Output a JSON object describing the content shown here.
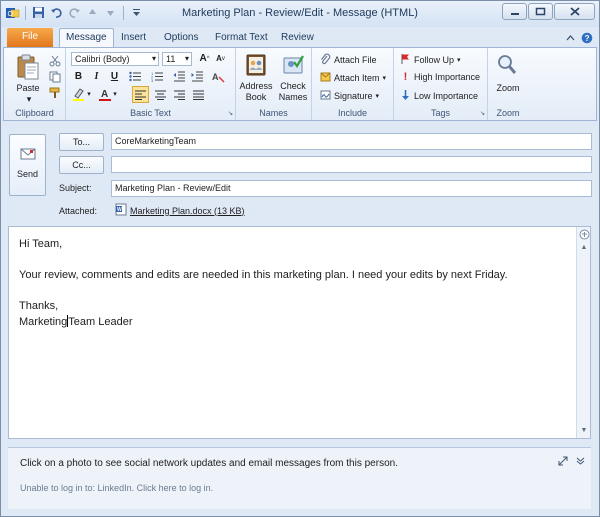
{
  "window": {
    "title": "Marketing Plan - Review/Edit - Message (HTML)"
  },
  "tabs": {
    "file": "File",
    "items": [
      "Message",
      "Insert",
      "Options",
      "Format Text",
      "Review"
    ]
  },
  "ribbon": {
    "clipboard": {
      "paste": "Paste",
      "label": "Clipboard"
    },
    "basic_text": {
      "font_name": "Calibri (Body)",
      "font_size": "11",
      "label": "Basic Text"
    },
    "names": {
      "address_book": "Address Book",
      "check_names": "Check Names",
      "label": "Names"
    },
    "include": {
      "attach_file": "Attach File",
      "attach_item": "Attach Item",
      "signature": "Signature",
      "label": "Include"
    },
    "tags": {
      "follow_up": "Follow Up",
      "high_importance": "High Importance",
      "low_importance": "Low Importance",
      "label": "Tags"
    },
    "zoom": {
      "zoom": "Zoom",
      "label": "Zoom"
    }
  },
  "header": {
    "send": "Send",
    "to_button": "To...",
    "cc_button": "Cc...",
    "to_value": "CoreMarketingTeam",
    "cc_value": "",
    "subject_label": "Subject:",
    "subject_value": "Marketing Plan - Review/Edit",
    "attached_label": "Attached:",
    "attachment": "Marketing Plan.docx (13 KB)"
  },
  "body": {
    "greeting": "Hi Team,",
    "line1": "Your review, comments and edits are needed in this marketing plan.  I need your edits by next Friday.",
    "thanks": "Thanks,",
    "signature_a": "Marketing",
    "signature_b": "Team Leader"
  },
  "people_pane": {
    "message": "Click on a photo to see social network updates and email messages from this person.",
    "login": "Unable to log in to: LinkedIn. Click here to log in."
  },
  "colors": {
    "file_tab": "#e2761b",
    "ribbon_bg": "#e3ecf7",
    "window_bg": "#dfe9f5",
    "font_color_bar": "#d01414",
    "highlight_bar": "#ffff00"
  }
}
